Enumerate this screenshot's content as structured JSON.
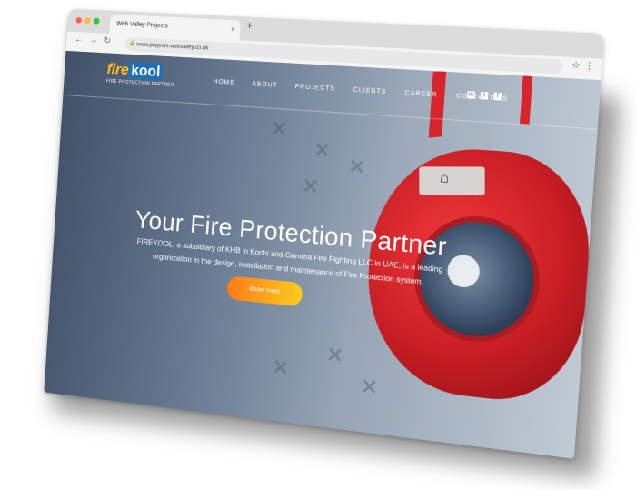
{
  "browser": {
    "tab_title": "Web Valley Projects",
    "tab_close": "×",
    "new_tab": "+",
    "url": "www.projects.webvalley.co.uk",
    "back": "←",
    "forward": "→",
    "reload": "↻",
    "star": "☆",
    "menu": "⋮"
  },
  "site": {
    "logo_fire": "fire",
    "logo_kool": "kool",
    "logo_tagline": "FIRE PROTECTION PARTNER",
    "nav": [
      "HOME",
      "ABOUT",
      "PROJECTS",
      "CLIENTS",
      "CAREER",
      "CONTACT US"
    ],
    "social": [
      "in",
      "t",
      "f"
    ],
    "hero_title": "Your Fire Protection Partner",
    "hero_desc": "FIREKOOL, a subsidiary of KHB in Kochi and Gamma Fire Fighting LLC in UAE, is a leading organization in the design, installation and maintenance of Fire Protection system.",
    "cta_label": "Know more"
  },
  "colors": {
    "brand_yellow": "#ffc21b",
    "brand_blue": "#1f6fb5",
    "cta_start": "#ff7a1a",
    "cta_end": "#ffcc1c",
    "alarm_red": "#c81e24"
  }
}
